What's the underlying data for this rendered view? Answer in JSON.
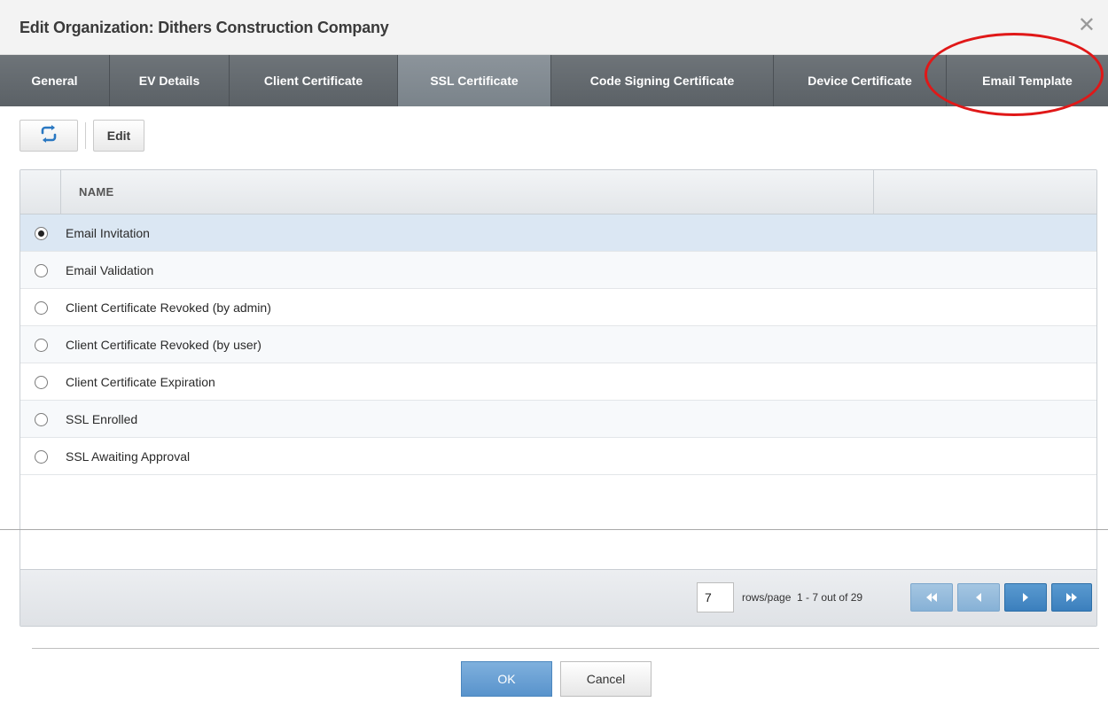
{
  "dialog": {
    "title": "Edit Organization: Dithers Construction Company"
  },
  "tabs": [
    {
      "label": "General"
    },
    {
      "label": "EV Details"
    },
    {
      "label": "Client Certificate"
    },
    {
      "label": "SSL Certificate",
      "active": true
    },
    {
      "label": "Code Signing Certificate"
    },
    {
      "label": "Device Certificate"
    },
    {
      "label": "Email Template",
      "highlighted": true
    }
  ],
  "toolbar": {
    "refresh_icon": "refresh-icon",
    "edit_label": "Edit"
  },
  "grid": {
    "column_name": "NAME",
    "rows": [
      {
        "name": "Email Invitation",
        "selected": true
      },
      {
        "name": "Email Validation"
      },
      {
        "name": "Client Certificate Revoked (by admin)"
      },
      {
        "name": "Client Certificate Revoked (by user)"
      },
      {
        "name": "Client Certificate Expiration"
      },
      {
        "name": "SSL Enrolled"
      },
      {
        "name": "SSL Awaiting Approval"
      }
    ]
  },
  "pagination": {
    "rows_per_page": "7",
    "rows_label": "rows/page",
    "range_text": "1 - 7 out of 29",
    "first_icon": "first-page-icon",
    "prev_icon": "prev-page-icon",
    "next_icon": "next-page-icon",
    "last_icon": "last-page-icon"
  },
  "buttons": {
    "ok": "OK",
    "cancel": "Cancel"
  },
  "colors": {
    "tab_bar": "#5b6166",
    "annotation": "#e01818",
    "selected_row": "#dbe7f3",
    "primary_button": "#5893cc"
  }
}
